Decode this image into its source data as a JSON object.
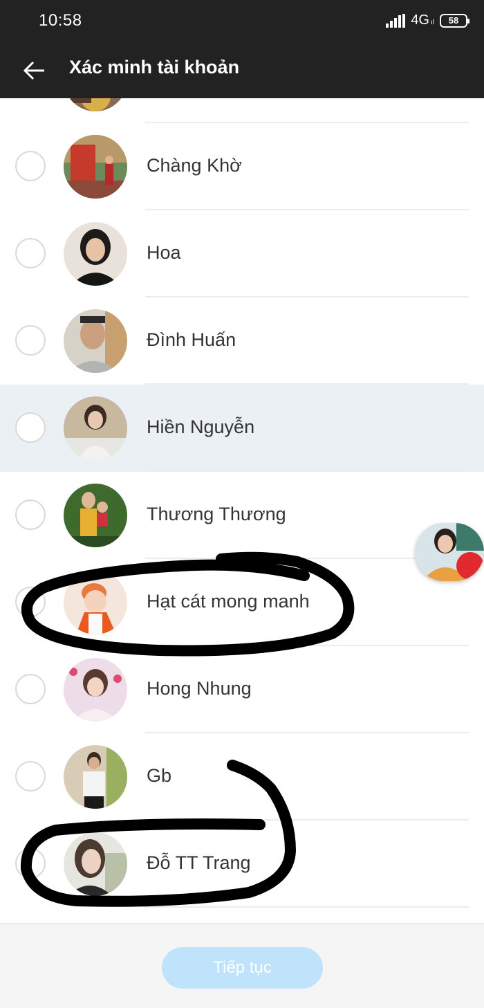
{
  "status_bar": {
    "time": "10:58",
    "network": "4G",
    "network_sub": "ıl",
    "battery": "58"
  },
  "header": {
    "title": "Xác minh tài khoản",
    "back_icon": "arrow-left-icon"
  },
  "contacts": [
    {
      "name": "",
      "selected": false,
      "highlighted": false
    },
    {
      "name": "Chàng Khờ",
      "selected": false,
      "highlighted": false
    },
    {
      "name": "Hoa",
      "selected": false,
      "highlighted": false
    },
    {
      "name": "Đình Huấn",
      "selected": false,
      "highlighted": false
    },
    {
      "name": "Hiền Nguyễn",
      "selected": false,
      "highlighted": true
    },
    {
      "name": "Thương Thương",
      "selected": false,
      "highlighted": false
    },
    {
      "name": "Hạt cát mong manh",
      "selected": false,
      "highlighted": false
    },
    {
      "name": "Hong Nhung",
      "selected": false,
      "highlighted": false
    },
    {
      "name": "Gb",
      "selected": false,
      "highlighted": false
    },
    {
      "name": "Đỗ TT Trang",
      "selected": false,
      "highlighted": false
    }
  ],
  "footer": {
    "continue_label": "Tiếp tục",
    "continue_enabled": false
  },
  "colors": {
    "header_bg": "#222222",
    "highlight_row": "#ebf0f5",
    "button_disabled": "#bfe3fb"
  }
}
